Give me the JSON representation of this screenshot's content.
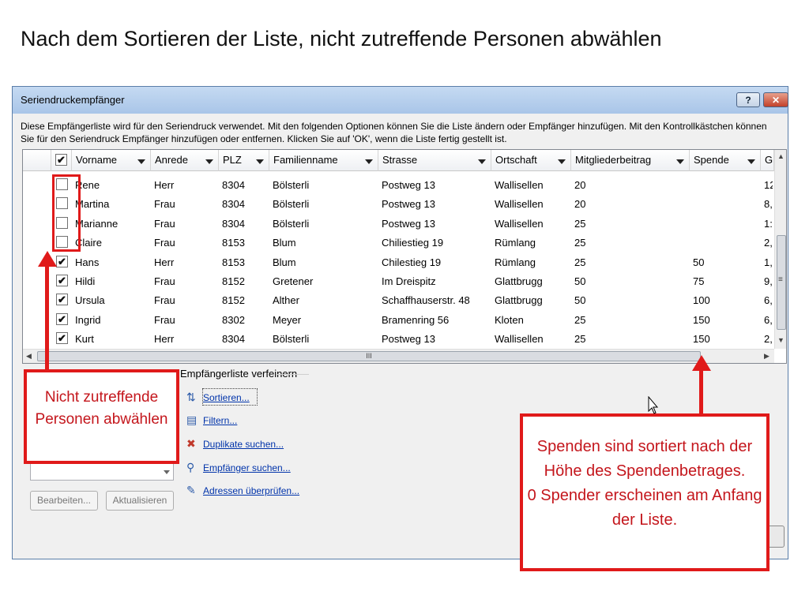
{
  "slide_title": "Nach dem Sortieren der Liste, nicht zutreffende Personen abwählen",
  "dialog": {
    "title": "Seriendruckempfänger",
    "help_label": "?",
    "description": "Diese Empfängerliste wird für den Seriendruck verwendet. Mit den folgenden Optionen können Sie die Liste ändern oder Empfänger hinzufügen. Mit den Kontrollkästchen können Sie für den Seriendruck Empfänger hinzufügen oder entfernen. Klicken Sie auf 'OK', wenn die Liste fertig gestellt ist."
  },
  "table": {
    "columns": [
      "Vorname",
      "Anrede",
      "PLZ",
      "Familienname",
      "Strasse",
      "Ortschaft",
      "Mitgliederbeitrag",
      "Spende",
      "G"
    ],
    "rows": [
      {
        "checked": false,
        "vorname": "Rene",
        "anrede": "Herr",
        "plz": "8304",
        "familienname": "Bölsterli",
        "strasse": "Postweg 13",
        "ortschaft": "Wallisellen",
        "beitrag": "20",
        "spende": "",
        "g": "12"
      },
      {
        "checked": false,
        "vorname": "Martina",
        "anrede": "Frau",
        "plz": "8304",
        "familienname": "Bölsterli",
        "strasse": "Postweg 13",
        "ortschaft": "Wallisellen",
        "beitrag": "20",
        "spende": "",
        "g": "8,"
      },
      {
        "checked": false,
        "vorname": "Marianne",
        "anrede": "Frau",
        "plz": "8304",
        "familienname": "Bölsterli",
        "strasse": "Postweg 13",
        "ortschaft": "Wallisellen",
        "beitrag": "25",
        "spende": "",
        "g": "1:"
      },
      {
        "checked": false,
        "vorname": "Claire",
        "anrede": "Frau",
        "plz": "8153",
        "familienname": "Blum",
        "strasse": "Chiliestieg 19",
        "ortschaft": "Rümlang",
        "beitrag": "25",
        "spende": "",
        "g": "2,"
      },
      {
        "checked": true,
        "vorname": "Hans",
        "anrede": "Herr",
        "plz": "8153",
        "familienname": "Blum",
        "strasse": "Chilestieg 19",
        "ortschaft": "Rümlang",
        "beitrag": "25",
        "spende": "50",
        "g": "1,"
      },
      {
        "checked": true,
        "vorname": "Hildi",
        "anrede": "Frau",
        "plz": "8152",
        "familienname": "Gretener",
        "strasse": "Im Dreispitz",
        "ortschaft": "Glattbrugg",
        "beitrag": "50",
        "spende": "75",
        "g": "9,"
      },
      {
        "checked": true,
        "vorname": "Ursula",
        "anrede": "Frau",
        "plz": "8152",
        "familienname": "Alther",
        "strasse": "Schaffhauserstr. 48",
        "ortschaft": "Glattbrugg",
        "beitrag": "50",
        "spende": "100",
        "g": "6,"
      },
      {
        "checked": true,
        "vorname": "Ingrid",
        "anrede": "Frau",
        "plz": "8302",
        "familienname": "Meyer",
        "strasse": "Bramenring 56",
        "ortschaft": "Kloten",
        "beitrag": "25",
        "spende": "150",
        "g": "6,"
      },
      {
        "checked": true,
        "vorname": "Kurt",
        "anrede": "Herr",
        "plz": "8304",
        "familienname": "Bölsterli",
        "strasse": "Postweg 13",
        "ortschaft": "Wallisellen",
        "beitrag": "25",
        "spende": "150",
        "g": "2,"
      }
    ],
    "hscroll_grip": "III",
    "vscroll_grip": "≡"
  },
  "refine": {
    "label": "Empfängerliste verfeinern",
    "links": [
      {
        "label": "Sortieren...",
        "icon": "sort-az-icon"
      },
      {
        "label": "Filtern...",
        "icon": "filter-icon"
      },
      {
        "label": "Duplikate suchen...",
        "icon": "duplicates-icon"
      },
      {
        "label": "Empfänger suchen...",
        "icon": "find-recipient-icon"
      },
      {
        "label": "Adressen überprüfen...",
        "icon": "validate-addresses-icon"
      }
    ]
  },
  "buttons": {
    "edit": "Bearbeiten...",
    "refresh": "Aktualisieren"
  },
  "callouts": {
    "left": "Nicht zutreffende Personen abwählen",
    "right_line1": "Spenden sind sortiert nach der Höhe des Spendenbetrages.",
    "right_line2": "0 Spender erscheinen am Anfang der Liste."
  },
  "colors": {
    "accent_red": "#e01a1a",
    "link_blue": "#0033aa"
  }
}
